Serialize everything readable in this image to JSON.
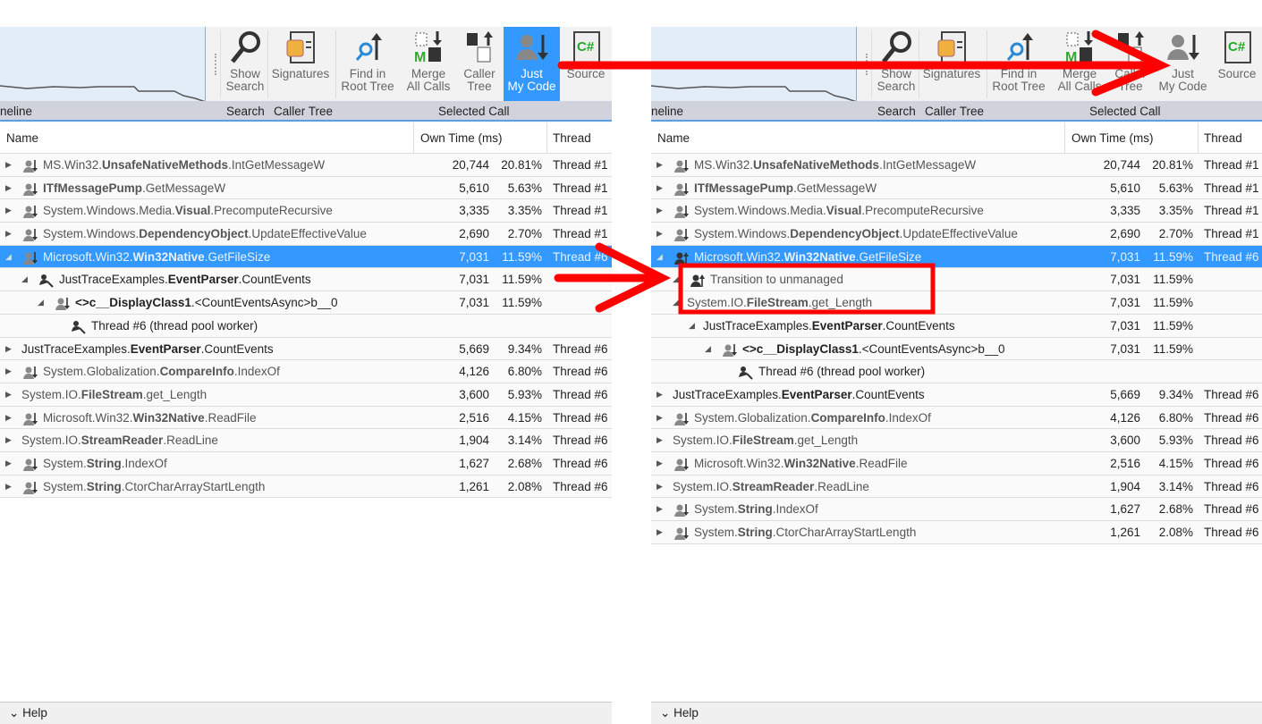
{
  "toolbar": {
    "buttons": [
      {
        "label1": "Show",
        "label2": "Search",
        "icon": "magnifier-icon"
      },
      {
        "label1": "Signatures",
        "label2": "",
        "icon": "scroll-document-icon"
      },
      {
        "label1": "Find in",
        "label2": "Root Tree",
        "icon": "find-root-icon"
      },
      {
        "label1": "Merge",
        "label2": "All Calls",
        "icon": "merge-calls-icon"
      },
      {
        "label1": "Caller",
        "label2": "Tree",
        "icon": "caller-tree-icon"
      },
      {
        "label1": "Just",
        "label2": "My Code",
        "icon": "just-my-code-icon"
      },
      {
        "label1": "Source",
        "label2": "",
        "icon": "csharp-source-icon"
      }
    ],
    "groups": {
      "timeline": "neline",
      "search": "Search",
      "caller_tree": "Caller Tree",
      "selected_call": "Selected Call"
    }
  },
  "columns": {
    "name": "Name",
    "own_time": "Own Time (ms)",
    "thread": "Thread"
  },
  "help": "Help",
  "accent": "#3399ff",
  "panels": [
    {
      "just_my_code_active": true,
      "rows": [
        {
          "indent": 0,
          "exp": "collapsed",
          "icon": "user-down-icon",
          "pre": "MS.Win32.",
          "bold": "UnsafeNativeMethods",
          "post": ".IntGetMessageW",
          "time": "20,744",
          "pct": "20.81%",
          "thread": "Thread #1",
          "grey": true
        },
        {
          "indent": 0,
          "exp": "collapsed",
          "icon": "user-down-icon",
          "pre": "",
          "bold": "ITfMessagePump",
          "post": ".GetMessageW",
          "time": "5,610",
          "pct": "5.63%",
          "thread": "Thread #1",
          "grey": true
        },
        {
          "indent": 0,
          "exp": "collapsed",
          "icon": "user-down-icon",
          "pre": "System.Windows.Media.",
          "bold": "Visual",
          "post": ".PrecomputeRecursive",
          "time": "3,335",
          "pct": "3.35%",
          "thread": "Thread #1",
          "grey": true
        },
        {
          "indent": 0,
          "exp": "collapsed",
          "icon": "user-down-icon",
          "pre": "System.Windows.",
          "bold": "DependencyObject",
          "post": ".UpdateEffectiveValue",
          "time": "2,690",
          "pct": "2.70%",
          "thread": "Thread #1",
          "grey": true
        },
        {
          "indent": 0,
          "exp": "expanded",
          "icon": "user-down-icon",
          "pre": "Microsoft.Win32.",
          "bold": "Win32Native",
          "post": ".GetFileSize",
          "time": "7,031",
          "pct": "11.59%",
          "thread": "Thread #6",
          "selected": true,
          "grey": true
        },
        {
          "indent": 1,
          "exp": "expanded",
          "icon": "worker-icon",
          "pre": "JustTraceExamples.",
          "bold": "EventParser",
          "post": ".CountEvents",
          "time": "7,031",
          "pct": "11.59%",
          "thread": ""
        },
        {
          "indent": 2,
          "exp": "expanded",
          "icon": "user-down-icon",
          "pre": "",
          "bold": "<>c__DisplayClass1",
          "post": ".<CountEventsAsync>b__0",
          "time": "7,031",
          "pct": "11.59%",
          "thread": ""
        },
        {
          "indent": 3,
          "exp": "none",
          "icon": "worker-icon",
          "pre": "Thread #6 (thread pool worker)",
          "bold": "",
          "post": "",
          "time": "",
          "pct": "",
          "thread": ""
        },
        {
          "indent": -1,
          "exp": "collapsed",
          "icon": "",
          "pre": "JustTraceExamples.",
          "bold": "EventParser",
          "post": ".CountEvents",
          "time": "5,669",
          "pct": "9.34%",
          "thread": "Thread #6"
        },
        {
          "indent": 0,
          "exp": "collapsed",
          "icon": "user-down-icon",
          "pre": "System.Globalization.",
          "bold": "CompareInfo",
          "post": ".IndexOf",
          "time": "4,126",
          "pct": "6.80%",
          "thread": "Thread #6",
          "grey": true
        },
        {
          "indent": -1,
          "exp": "collapsed",
          "icon": "",
          "pre": "System.IO.",
          "bold": "FileStream",
          "post": ".get_Length",
          "time": "3,600",
          "pct": "5.93%",
          "thread": "Thread #6",
          "grey": true
        },
        {
          "indent": 0,
          "exp": "collapsed",
          "icon": "user-down-icon",
          "pre": "Microsoft.Win32.",
          "bold": "Win32Native",
          "post": ".ReadFile",
          "time": "2,516",
          "pct": "4.15%",
          "thread": "Thread #6",
          "grey": true
        },
        {
          "indent": -1,
          "exp": "collapsed",
          "icon": "",
          "pre": "System.IO.",
          "bold": "StreamReader",
          "post": ".ReadLine",
          "time": "1,904",
          "pct": "3.14%",
          "thread": "Thread #6",
          "grey": true
        },
        {
          "indent": 0,
          "exp": "collapsed",
          "icon": "user-down-icon",
          "pre": "System.",
          "bold": "String",
          "post": ".IndexOf",
          "time": "1,627",
          "pct": "2.68%",
          "thread": "Thread #6",
          "grey": true
        },
        {
          "indent": 0,
          "exp": "collapsed",
          "icon": "user-down-icon",
          "pre": "System.",
          "bold": "String",
          "post": ".CtorCharArrayStartLength",
          "time": "1,261",
          "pct": "2.08%",
          "thread": "Thread #6",
          "grey": true
        }
      ]
    },
    {
      "just_my_code_active": false,
      "rows": [
        {
          "indent": 0,
          "exp": "collapsed",
          "icon": "user-down-icon",
          "pre": "MS.Win32.",
          "bold": "UnsafeNativeMethods",
          "post": ".IntGetMessageW",
          "time": "20,744",
          "pct": "20.81%",
          "thread": "Thread #1",
          "grey": true
        },
        {
          "indent": 0,
          "exp": "collapsed",
          "icon": "user-down-icon",
          "pre": "",
          "bold": "ITfMessagePump",
          "post": ".GetMessageW",
          "time": "5,610",
          "pct": "5.63%",
          "thread": "Thread #1",
          "grey": true
        },
        {
          "indent": 0,
          "exp": "collapsed",
          "icon": "user-down-icon",
          "pre": "System.Windows.Media.",
          "bold": "Visual",
          "post": ".PrecomputeRecursive",
          "time": "3,335",
          "pct": "3.35%",
          "thread": "Thread #1",
          "grey": true
        },
        {
          "indent": 0,
          "exp": "collapsed",
          "icon": "user-down-icon",
          "pre": "System.Windows.",
          "bold": "DependencyObject",
          "post": ".UpdateEffectiveValue",
          "time": "2,690",
          "pct": "2.70%",
          "thread": "Thread #1",
          "grey": true
        },
        {
          "indent": 0,
          "exp": "expanded",
          "icon": "user-up-icon",
          "pre": "Microsoft.Win32.",
          "bold": "Win32Native",
          "post": ".GetFileSize",
          "time": "7,031",
          "pct": "11.59%",
          "thread": "Thread #6",
          "selected": true,
          "grey": true
        },
        {
          "indent": 1,
          "exp": "expanded",
          "icon": "user-up-icon",
          "pre": "Transition to unmanaged",
          "bold": "",
          "post": "",
          "time": "7,031",
          "pct": "11.59%",
          "thread": "",
          "grey": true
        },
        {
          "indent": 1,
          "exp": "expanded",
          "icon": "",
          "pre": "System.IO.",
          "bold": "FileStream",
          "post": ".get_Length",
          "time": "7,031",
          "pct": "11.59%",
          "thread": "",
          "grey": true
        },
        {
          "indent": 2,
          "exp": "expanded",
          "icon": "",
          "pre": "JustTraceExamples.",
          "bold": "EventParser",
          "post": ".CountEvents",
          "time": "7,031",
          "pct": "11.59%",
          "thread": ""
        },
        {
          "indent": 3,
          "exp": "expanded",
          "icon": "user-down-icon",
          "pre": "",
          "bold": "<>c__DisplayClass1",
          "post": ".<CountEventsAsync>b__0",
          "time": "7,031",
          "pct": "11.59%",
          "thread": ""
        },
        {
          "indent": 4,
          "exp": "none",
          "icon": "worker-icon",
          "pre": "Thread #6 (thread pool worker)",
          "bold": "",
          "post": "",
          "time": "",
          "pct": "",
          "thread": ""
        },
        {
          "indent": -1,
          "exp": "collapsed",
          "icon": "",
          "pre": "JustTraceExamples.",
          "bold": "EventParser",
          "post": ".CountEvents",
          "time": "5,669",
          "pct": "9.34%",
          "thread": "Thread #6"
        },
        {
          "indent": 0,
          "exp": "collapsed",
          "icon": "user-down-icon",
          "pre": "System.Globalization.",
          "bold": "CompareInfo",
          "post": ".IndexOf",
          "time": "4,126",
          "pct": "6.80%",
          "thread": "Thread #6",
          "grey": true
        },
        {
          "indent": -1,
          "exp": "collapsed",
          "icon": "",
          "pre": "System.IO.",
          "bold": "FileStream",
          "post": ".get_Length",
          "time": "3,600",
          "pct": "5.93%",
          "thread": "Thread #6",
          "grey": true
        },
        {
          "indent": 0,
          "exp": "collapsed",
          "icon": "user-down-icon",
          "pre": "Microsoft.Win32.",
          "bold": "Win32Native",
          "post": ".ReadFile",
          "time": "2,516",
          "pct": "4.15%",
          "thread": "Thread #6",
          "grey": true
        },
        {
          "indent": -1,
          "exp": "collapsed",
          "icon": "",
          "pre": "System.IO.",
          "bold": "StreamReader",
          "post": ".ReadLine",
          "time": "1,904",
          "pct": "3.14%",
          "thread": "Thread #6",
          "grey": true
        },
        {
          "indent": 0,
          "exp": "collapsed",
          "icon": "user-down-icon",
          "pre": "System.",
          "bold": "String",
          "post": ".IndexOf",
          "time": "1,627",
          "pct": "2.68%",
          "thread": "Thread #6",
          "grey": true
        },
        {
          "indent": 0,
          "exp": "collapsed",
          "icon": "user-down-icon",
          "pre": "System.",
          "bold": "String",
          "post": ".CtorCharArrayStartLength",
          "time": "1,261",
          "pct": "2.08%",
          "thread": "Thread #6",
          "grey": true
        }
      ]
    }
  ],
  "annotation_color": "#ff0000"
}
